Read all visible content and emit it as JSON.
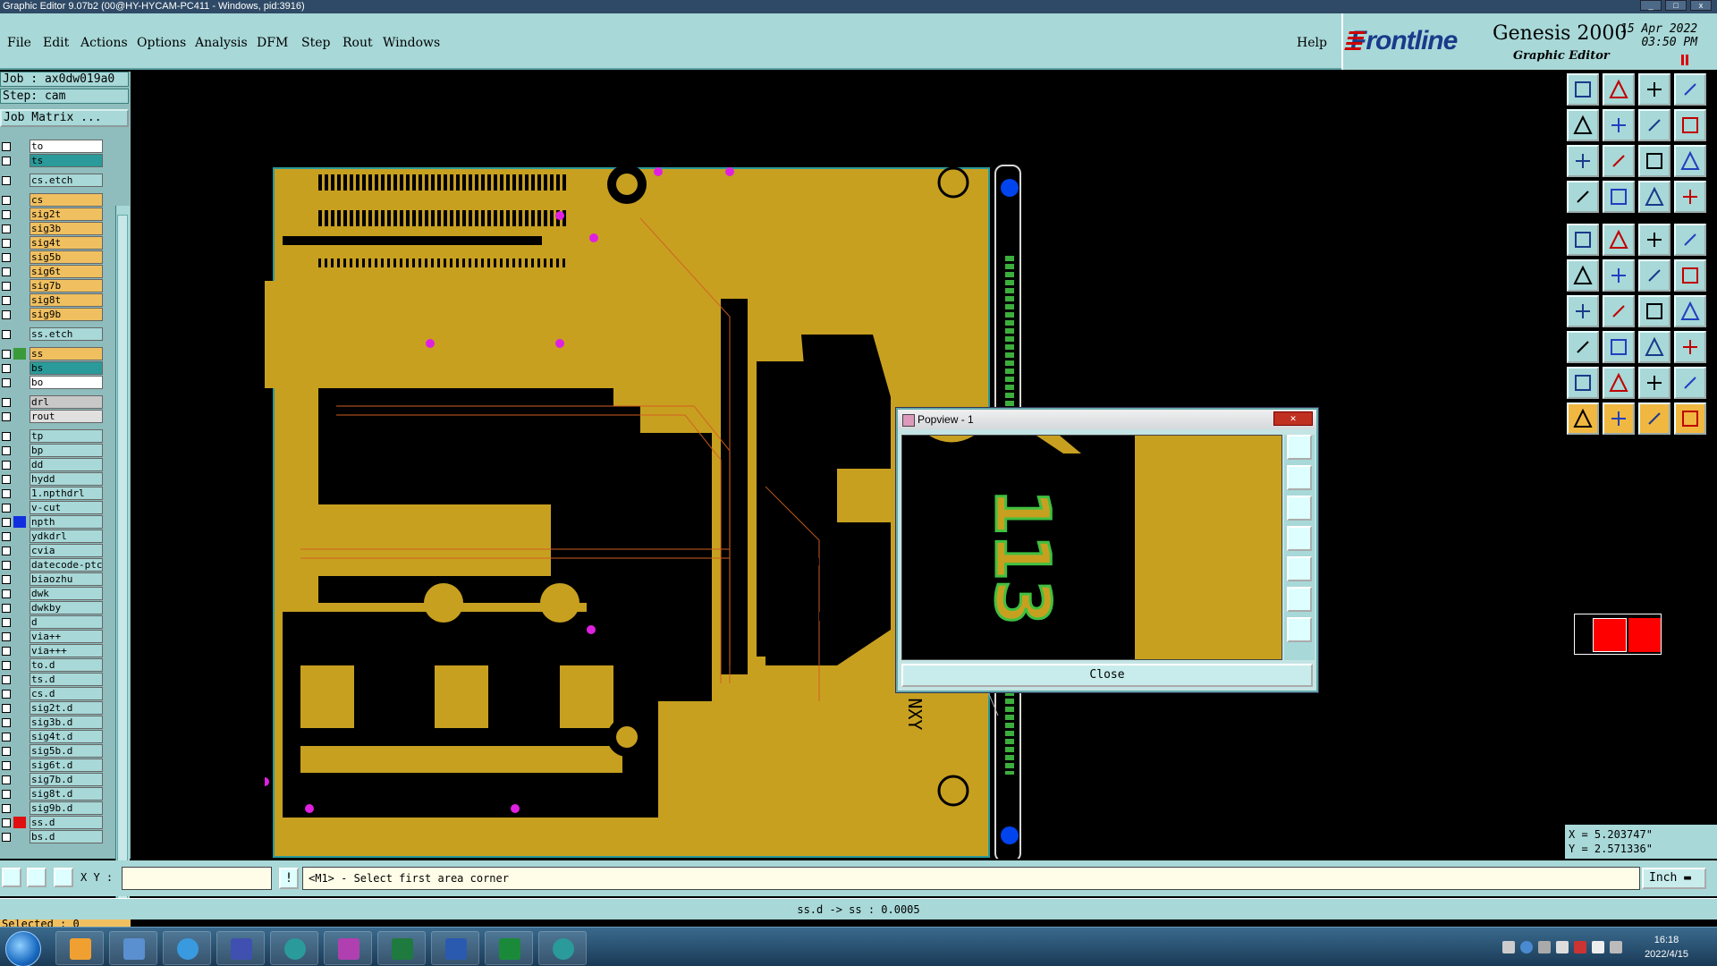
{
  "window": {
    "title": "Graphic Editor 9.07b2 (00@HY-HYCAM-PC411 - Windows, pid:3916)"
  },
  "menu": {
    "items": [
      "File",
      "Edit",
      "Actions",
      "Options",
      "Analysis",
      "DFM",
      "Step",
      "Rout",
      "Windows"
    ],
    "help": "Help"
  },
  "brand": {
    "logo": "Frontline",
    "product": "Genesis 2000",
    "subtitle": "Graphic Editor",
    "date": "15 Apr 2022",
    "time": "03:50 PM"
  },
  "job": {
    "job_line": "Job : ax0dw019a0",
    "step_line": "Step: cam",
    "matrix_button": "Job Matrix ..."
  },
  "layers": [
    {
      "name": "to",
      "color": "#ffffff",
      "swatch": ""
    },
    {
      "name": "ts",
      "color": "#2a9a9a",
      "swatch": ""
    },
    {
      "name": "cs.etch",
      "color": "#a8d8d8",
      "swatch": ""
    },
    {
      "name": "cs",
      "color": "#f0c060",
      "swatch": ""
    },
    {
      "name": "sig2t",
      "color": "#f0c060",
      "swatch": ""
    },
    {
      "name": "sig3b",
      "color": "#f0c060",
      "swatch": ""
    },
    {
      "name": "sig4t",
      "color": "#f0c060",
      "swatch": ""
    },
    {
      "name": "sig5b",
      "color": "#f0c060",
      "swatch": ""
    },
    {
      "name": "sig6t",
      "color": "#f0c060",
      "swatch": ""
    },
    {
      "name": "sig7b",
      "color": "#f0c060",
      "swatch": ""
    },
    {
      "name": "sig8t",
      "color": "#f0c060",
      "swatch": ""
    },
    {
      "name": "sig9b",
      "color": "#f0c060",
      "swatch": ""
    },
    {
      "name": "ss.etch",
      "color": "#a8d8d8",
      "swatch": ""
    },
    {
      "name": "ss",
      "color": "#f0c060",
      "swatch": "#3a9a3a"
    },
    {
      "name": "bs",
      "color": "#2a9a9a",
      "swatch": ""
    },
    {
      "name": "bo",
      "color": "#ffffff",
      "swatch": ""
    },
    {
      "name": "drl",
      "color": "#c8c8c8",
      "swatch": ""
    },
    {
      "name": "rout",
      "color": "#e0e0e0",
      "swatch": ""
    },
    {
      "name": "tp",
      "color": "#a8d8d8",
      "swatch": ""
    },
    {
      "name": "bp",
      "color": "#a8d8d8",
      "swatch": ""
    },
    {
      "name": "dd",
      "color": "#a8d8d8",
      "swatch": ""
    },
    {
      "name": "hydd",
      "color": "#a8d8d8",
      "swatch": ""
    },
    {
      "name": "1.npthdrl",
      "color": "#a8d8d8",
      "swatch": ""
    },
    {
      "name": "v-cut",
      "color": "#a8d8d8",
      "swatch": ""
    },
    {
      "name": "npth",
      "color": "#a8d8d8",
      "swatch": "#1030e0"
    },
    {
      "name": "ydkdrl",
      "color": "#a8d8d8",
      "swatch": ""
    },
    {
      "name": "cvia",
      "color": "#a8d8d8",
      "swatch": ""
    },
    {
      "name": "datecode-ptc",
      "color": "#a8d8d8",
      "swatch": ""
    },
    {
      "name": "biaozhu",
      "color": "#a8d8d8",
      "swatch": ""
    },
    {
      "name": "dwk",
      "color": "#a8d8d8",
      "swatch": ""
    },
    {
      "name": "dwkby",
      "color": "#a8d8d8",
      "swatch": ""
    },
    {
      "name": "d",
      "color": "#a8d8d8",
      "swatch": ""
    },
    {
      "name": "via++",
      "color": "#a8d8d8",
      "swatch": ""
    },
    {
      "name": "via+++",
      "color": "#a8d8d8",
      "swatch": ""
    },
    {
      "name": "to.d",
      "color": "#a8d8d8",
      "swatch": ""
    },
    {
      "name": "ts.d",
      "color": "#a8d8d8",
      "swatch": ""
    },
    {
      "name": "cs.d",
      "color": "#a8d8d8",
      "swatch": ""
    },
    {
      "name": "sig2t.d",
      "color": "#a8d8d8",
      "swatch": ""
    },
    {
      "name": "sig3b.d",
      "color": "#a8d8d8",
      "swatch": ""
    },
    {
      "name": "sig4t.d",
      "color": "#a8d8d8",
      "swatch": ""
    },
    {
      "name": "sig5b.d",
      "color": "#a8d8d8",
      "swatch": ""
    },
    {
      "name": "sig6t.d",
      "color": "#a8d8d8",
      "swatch": ""
    },
    {
      "name": "sig7b.d",
      "color": "#a8d8d8",
      "swatch": ""
    },
    {
      "name": "sig8t.d",
      "color": "#a8d8d8",
      "swatch": ""
    },
    {
      "name": "sig9b.d",
      "color": "#a8d8d8",
      "swatch": ""
    },
    {
      "name": "ss.d",
      "color": "#a8d8d8",
      "swatch": "#e01010"
    },
    {
      "name": "bs.d",
      "color": "#a8d8d8",
      "swatch": ""
    }
  ],
  "selected": "Selected : 0",
  "popview": {
    "title": "Popview - 1",
    "close_label": "Close",
    "zoom_text": "113"
  },
  "board": {
    "silk_text": "BSO 130  NXY"
  },
  "coords": {
    "x": "X = 5.203747\"",
    "y": "Y = 2.571336\""
  },
  "command": {
    "xy_label": "X Y :",
    "xy_value": "",
    "prompt": "<M1> - Select first area corner",
    "unit": "Inch"
  },
  "status": {
    "text": "ss.d -> ss : 0.0005"
  },
  "taskbar": {
    "time": "16:18",
    "date": "2022/4/15"
  },
  "colors": {
    "copper": "#c8a020",
    "panel": "#a8d8d8",
    "active": "#f0c060"
  }
}
